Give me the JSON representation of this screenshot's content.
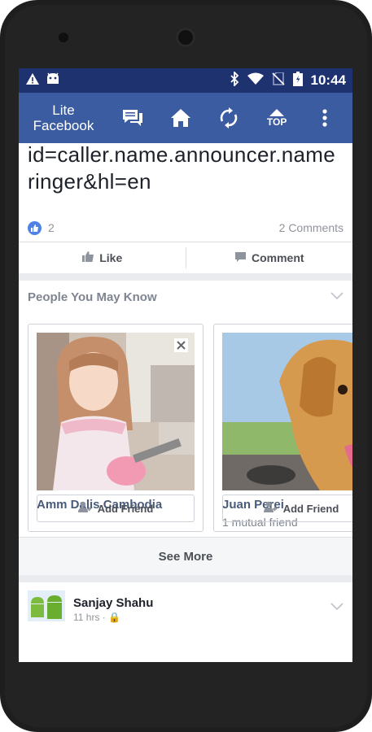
{
  "status_bar": {
    "time": "10:44",
    "icons": [
      "warning-icon",
      "android-icon",
      "bluetooth-icon",
      "wifi-icon",
      "no-sim-icon",
      "battery-icon"
    ]
  },
  "app_bar": {
    "title_line1": "Lite",
    "title_line2": "Facebook",
    "top_label": "TOP",
    "icons": [
      "messages-icon",
      "home-icon",
      "refresh-icon",
      "top-icon",
      "overflow-menu-icon"
    ],
    "color": "#3b5ca0"
  },
  "post": {
    "text_line1": "id=caller.name.announcer.name",
    "text_line2": "ringer&hl=en",
    "likes": "2",
    "comments": "2 Comments",
    "like_label": "Like",
    "comment_label": "Comment"
  },
  "pymk": {
    "title": "People You May Know",
    "people": [
      {
        "name": "Amm Dalis Cambodia",
        "mutual": "",
        "add_label": "Add Friend"
      },
      {
        "name": "Juan Perei",
        "mutual": "1 mutual friend",
        "add_label": "Add Friend"
      }
    ],
    "see_more": "See More"
  },
  "next_post": {
    "name": "Sanjay Shahu",
    "meta": "11 hrs · 🔒"
  },
  "colors": {
    "status_bar": "#1f3270",
    "like_blue": "#4f82e6"
  }
}
